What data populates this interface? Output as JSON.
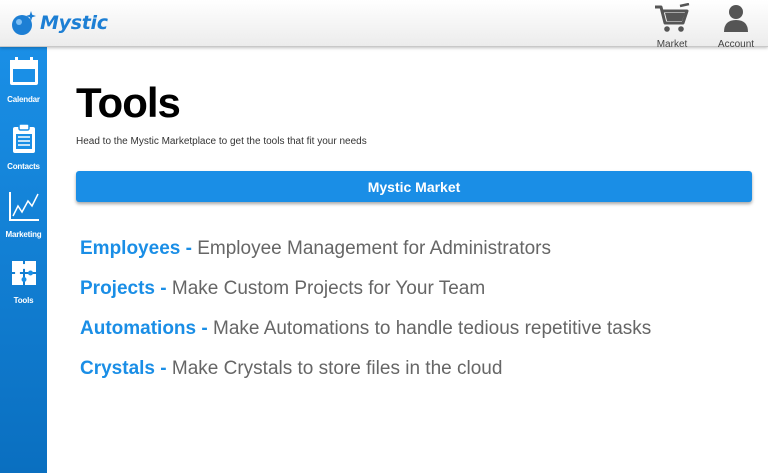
{
  "app": {
    "name": "Mystic"
  },
  "colors": {
    "accent": "#1a8ee6",
    "sidebar_top": "#1a8fe6",
    "sidebar_bottom": "#0a6fc0"
  },
  "header": {
    "actions": [
      {
        "label": "Market",
        "icon": "cart-icon"
      },
      {
        "label": "Account",
        "icon": "person-icon"
      }
    ]
  },
  "sidebar": {
    "items": [
      {
        "label": "Calendar",
        "icon": "calendar-icon"
      },
      {
        "label": "Contacts",
        "icon": "clipboard-icon"
      },
      {
        "label": "Marketing",
        "icon": "line-chart-icon"
      },
      {
        "label": "Tools",
        "icon": "puzzle-icon"
      }
    ]
  },
  "main": {
    "title": "Tools",
    "subtitle": "Head to the Mystic Marketplace to get the tools that fit your needs",
    "market_button": "Mystic Market",
    "tools": [
      {
        "name": "Employees - ",
        "description": "Employee Management for Administrators"
      },
      {
        "name": "Projects - ",
        "description": "Make Custom Projects for Your Team"
      },
      {
        "name": "Automations - ",
        "description": "Make Automations to handle tedious repetitive tasks"
      },
      {
        "name": "Crystals - ",
        "description": "Make Crystals to store files in the cloud"
      }
    ]
  }
}
